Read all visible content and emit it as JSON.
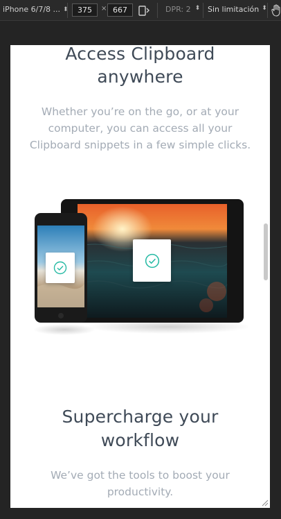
{
  "devtools": {
    "device_label": "iPhone 6/7/8 ...",
    "width_value": "375",
    "times_symbol": "×",
    "height_value": "667",
    "dpr_label": "DPR: 2",
    "throttle_label": "Sin limitación",
    "icons": [
      "caret-updown-icon",
      "rotate-icon",
      "hand-icon"
    ]
  },
  "page": {
    "section1": {
      "title_line1": "Access Clipboard",
      "title_line2": "anywhere",
      "text_line1": "Whether you’re on the go, or at your",
      "text_line2": "computer, you can access all your",
      "text_line3": "Clipboard snippets in a few simple clicks."
    },
    "section2": {
      "title_line1": "Supercharge your",
      "title_line2": "workflow",
      "text_line1": "We’ve got the tools to boost your",
      "text_line2": "productivity."
    }
  },
  "colors": {
    "heading": "#3f4a57",
    "body_text": "#a3abb5",
    "check_accent": "#26baa4"
  }
}
